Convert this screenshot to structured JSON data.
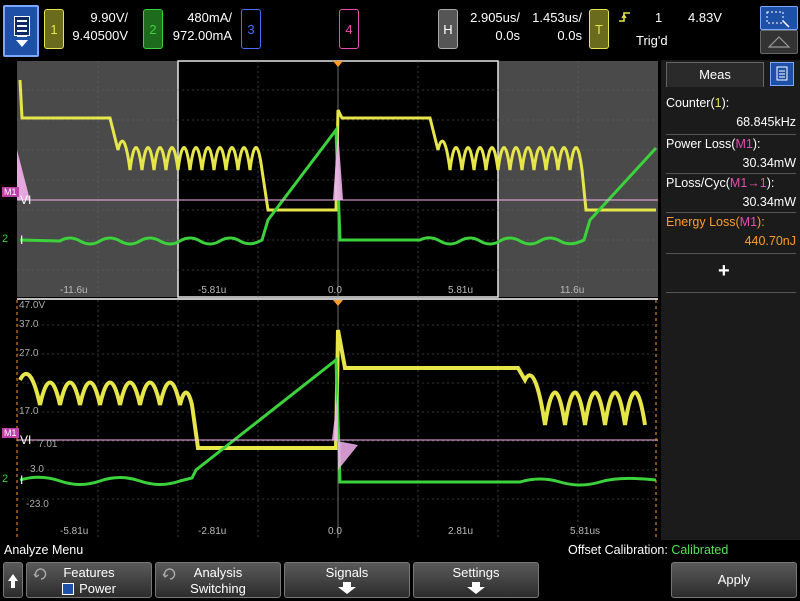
{
  "top": {
    "ch1": {
      "label": "1",
      "scale": "9.90V/",
      "offset": "9.40500V",
      "color": "#e6e54a"
    },
    "ch2": {
      "label": "2",
      "scale": "480mA/",
      "offset": "972.00mA",
      "color": "#3cd23c"
    },
    "ch3": {
      "label": "3"
    },
    "ch4": {
      "label": "4"
    },
    "horizontal": {
      "label": "H",
      "scale1": "2.905us/",
      "scale2": "1.453us/",
      "pos1": "0.0s",
      "pos2": "0.0s"
    },
    "trigger": {
      "label": "T",
      "source": "1",
      "level": "4.83V",
      "status": "Trig'd"
    }
  },
  "main_waveform": {
    "bottom_labels": [
      "-11.6u",
      "-5.81u",
      "0.0",
      "5.81u",
      "11.6u"
    ],
    "markers": {
      "vi": "VI",
      "i": "I",
      "m1": "M1",
      "ch2": "2"
    }
  },
  "zoom_waveform": {
    "y_labels": [
      "47.0V",
      "37.0",
      "27.0",
      "17.0",
      "7.01",
      "3.0",
      "-23.0"
    ],
    "bottom_labels": [
      "-5.81u",
      "-2.81u",
      "0.0",
      "2.81u",
      "5.81us"
    ],
    "markers": {
      "vi": "VI",
      "i": "I",
      "m1": "M1",
      "ch2": "2"
    }
  },
  "meas_panel": {
    "tab_label": "Meas",
    "rows": [
      {
        "name": "Counter(",
        "src": "1",
        "tail": "):",
        "value": "68.845kHz"
      },
      {
        "name": "Power Loss(",
        "src": "M1",
        "tail": "):",
        "value": "30.34mW"
      },
      {
        "name": "PLoss/Cyc(",
        "src": "M1→1",
        "tail": "):",
        "value": "30.34mW"
      },
      {
        "name": "Energy Loss(",
        "src": "M1",
        "tail": "):",
        "value": "440.70nJ"
      }
    ],
    "add_symbol": "+"
  },
  "bottom": {
    "menu_title": "Analyze Menu",
    "calibration_label": "Offset Calibration:",
    "calibration_value": "Calibrated",
    "features_label": "Features",
    "features_value": "Power",
    "analysis_label": "Analysis",
    "analysis_value": "Switching",
    "signals_label": "Signals",
    "settings_label": "Settings",
    "apply_label": "Apply"
  },
  "colors": {
    "ch1": "#e6e54a",
    "ch2": "#3cd23c",
    "ch3": "#4a6cff",
    "ch4": "#e84cb0",
    "math": "#f5b2f0",
    "accent_orange": "#ff9c2a",
    "calibrated": "#54e354"
  }
}
